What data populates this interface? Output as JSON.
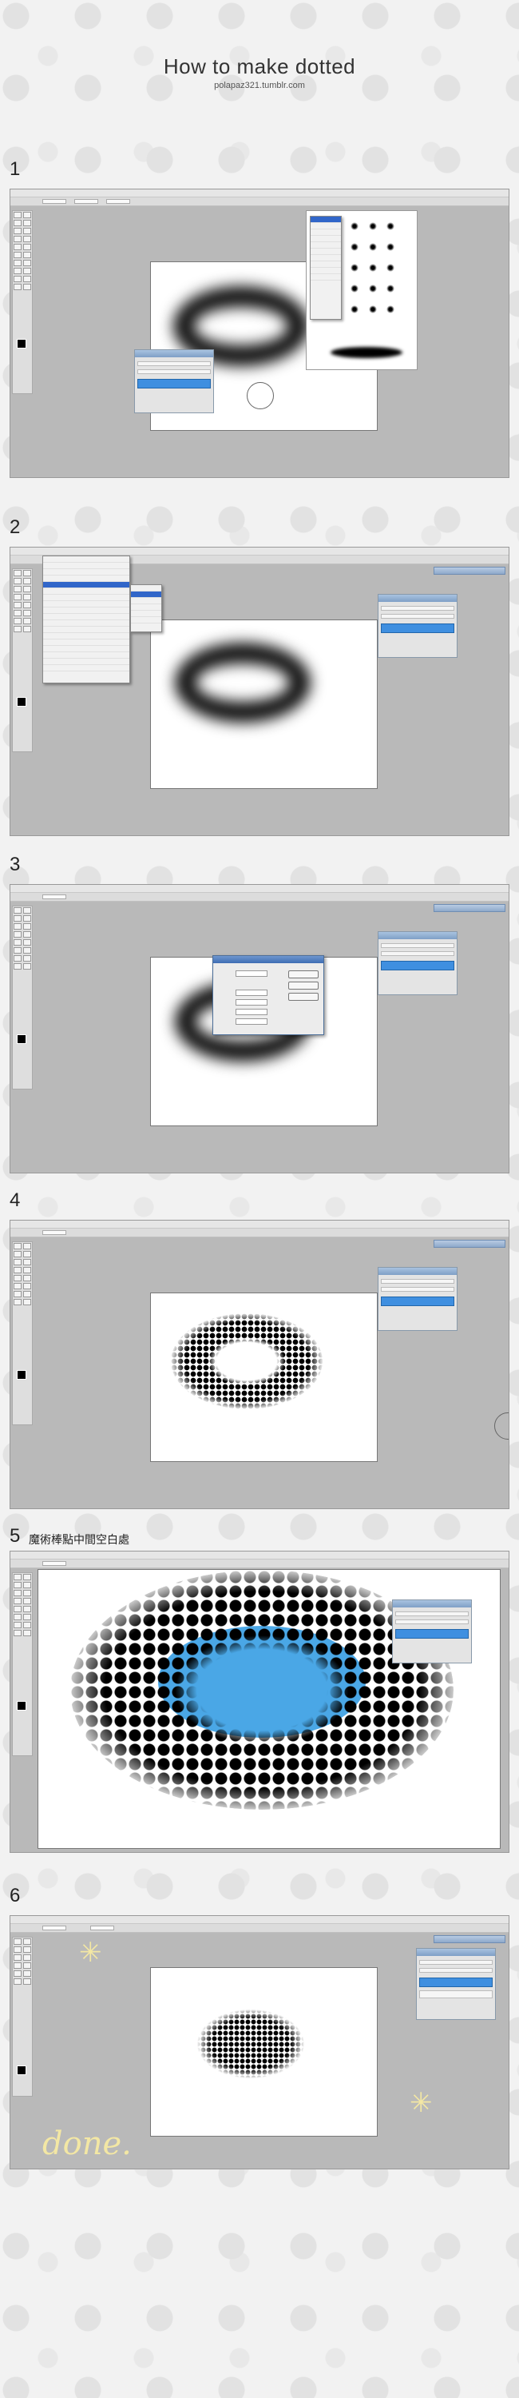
{
  "header": {
    "title": "How to make dotted",
    "subtitle": "polapaz321.tumblr.com"
  },
  "steps": [
    {
      "number": "1",
      "caption": ""
    },
    {
      "number": "2",
      "caption": ""
    },
    {
      "number": "3",
      "caption": ""
    },
    {
      "number": "4",
      "caption": ""
    },
    {
      "number": "5",
      "caption": "魔術棒點中間空白處"
    },
    {
      "number": "6",
      "caption": ""
    }
  ],
  "final_note": "done.",
  "colors": {
    "selection_blue": "#4aa7e6",
    "menu_highlight": "#3166c9",
    "highlight_doodle": "#f3e7a4"
  },
  "icons": [
    "sparkle-icon"
  ]
}
